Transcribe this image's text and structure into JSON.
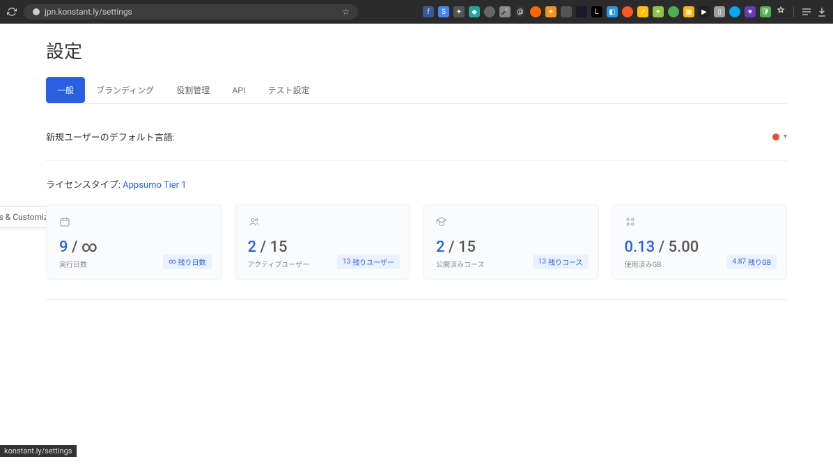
{
  "browser": {
    "url": "jpn.konstant.ly/settings",
    "status_url": "konstant.ly/settings"
  },
  "page": {
    "title": "設定"
  },
  "tabs": [
    {
      "label": "一般",
      "active": true
    },
    {
      "label": "ブランディング",
      "active": false
    },
    {
      "label": "役割管理",
      "active": false
    },
    {
      "label": "API",
      "active": false
    },
    {
      "label": "テスト設定",
      "active": false
    }
  ],
  "default_language": {
    "label": "新規ユーザーのデフォルト言語:"
  },
  "license": {
    "label": "ライセンスタイプ: ",
    "link": "Appsumo Tier 1"
  },
  "tooltip": "Settings & Customization",
  "cards": [
    {
      "value": "9",
      "total": "∞",
      "sub": "実行日数",
      "badge_prefix": "∞",
      "badge_text": "残り日数",
      "icon": "calendar"
    },
    {
      "value": "2",
      "total": "15",
      "sub": "アクティブユーザー",
      "badge_prefix": "13",
      "badge_text": "残りユーザー",
      "icon": "users"
    },
    {
      "value": "2",
      "total": "15",
      "sub": "公開済みコース",
      "badge_prefix": "13",
      "badge_text": "残りコース",
      "icon": "course"
    },
    {
      "value": "0.13",
      "total": "5.00",
      "sub": "使用済みGB",
      "badge_prefix": "4.87",
      "badge_text": "残りGB",
      "icon": "storage"
    }
  ]
}
